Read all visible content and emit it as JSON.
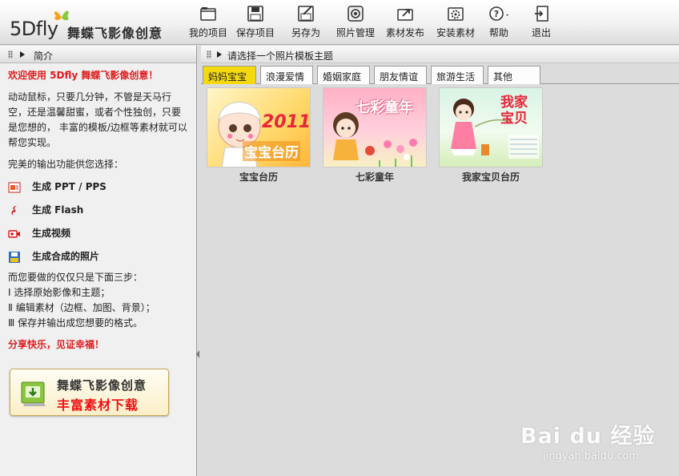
{
  "logo": {
    "brand": "5Dfly",
    "name": "舞蝶飞影像创意"
  },
  "toolbar": [
    {
      "label": "我的项目",
      "icon": "folder-icon"
    },
    {
      "label": "保存项目",
      "icon": "floppy-icon"
    },
    {
      "label": "另存为",
      "icon": "save-as-icon"
    },
    {
      "label": "照片管理",
      "icon": "photo-manager-icon"
    },
    {
      "label": "素材发布",
      "icon": "publish-icon"
    },
    {
      "label": "安装素材",
      "icon": "install-icon"
    },
    {
      "label": "帮助",
      "icon": "help-icon"
    },
    {
      "label": "退出",
      "icon": "exit-icon"
    }
  ],
  "left_panel": {
    "title": "简介",
    "welcome": "欢迎使用 5Dfly 舞蝶飞影像创意！",
    "description": "动动鼠标，只要几分钟，不管是天马行空，还是温馨甜蜜，或者个性独创，只要是您想的， 丰富的模板/边框等素材就可以帮您实现。",
    "output_intro": "完美的输出功能供您选择：",
    "features": [
      {
        "label": "生成 PPT / PPS",
        "icon": "ppt-icon"
      },
      {
        "label": "生成 Flash",
        "icon": "flash-icon"
      },
      {
        "label": "生成视频",
        "icon": "video-icon"
      },
      {
        "label": "生成合成的照片",
        "icon": "photo-save-icon"
      }
    ],
    "steps_intro": "而您要做的仅仅只是下面三步：",
    "steps": [
      "Ⅰ 选择原始影像和主题；",
      "Ⅱ 编辑素材（边框、加图、背景）；",
      "Ⅲ 保存并输出成您想要的格式。"
    ],
    "slogan": "分享快乐，见证幸福！",
    "banner": {
      "line1": "舞蝶飞影像创意",
      "line2": "丰富素材下载"
    }
  },
  "right_panel": {
    "title": "请选择一个照片模板主题",
    "tabs": [
      "妈妈宝宝",
      "浪漫爱情",
      "婚姻家庭",
      "朋友情谊",
      "旅游生活",
      "其他"
    ],
    "active_tab": "妈妈宝宝",
    "templates": [
      {
        "label": "宝宝台历",
        "image_text_1": "2011",
        "image_text_2": "宝宝台历"
      },
      {
        "label": "七彩童年",
        "image_text_1": "七彩童年"
      },
      {
        "label": "我家宝贝台历",
        "image_text_1": "我家",
        "image_text_2": "宝贝"
      }
    ]
  },
  "watermark": {
    "text": "Bai du 经验",
    "sub": "jingyan.baidu.com"
  },
  "colors": {
    "active_tab": "#f5d90f",
    "accent_red": "#e01c1c",
    "panel_bg": "#f0f0f0",
    "content_bg": "#dcdcdc"
  }
}
